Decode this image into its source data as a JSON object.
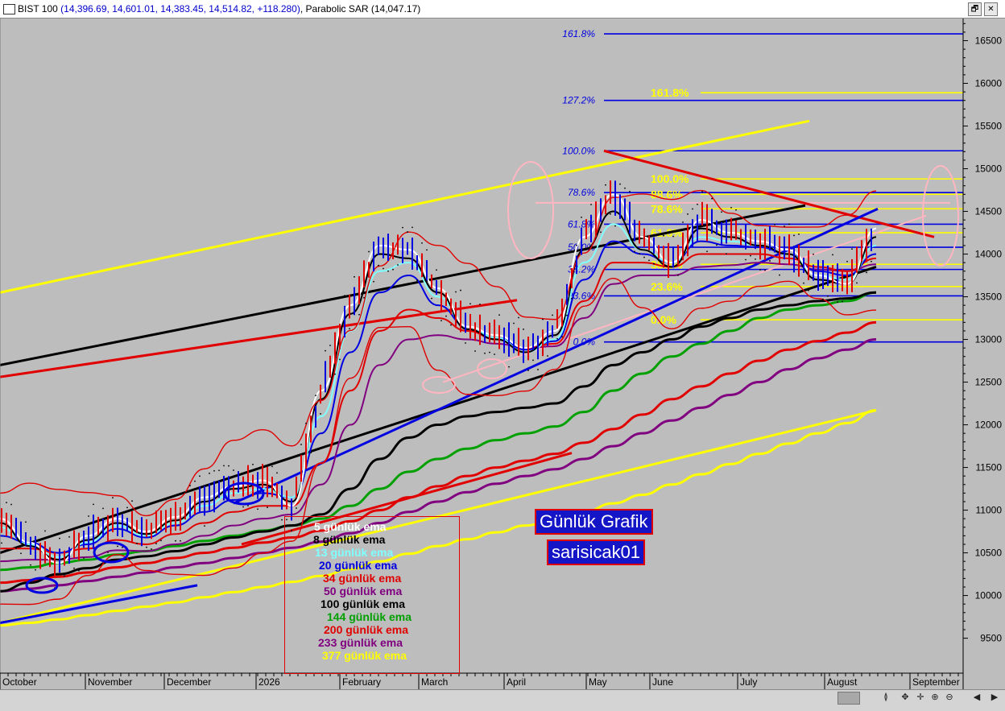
{
  "window": {
    "title_prefix": "BIST 100",
    "title_ohlc": " (14,396.69, 14,601.01, 14,383.45, 14,514.82, +118.280)",
    "title_suffix": ", Parabolic SAR (14,047.17)",
    "restore_label": "🗗",
    "close_label": "✕"
  },
  "overlays": {
    "label_1": "Günlük Grafik",
    "label_2": "sarisicak01"
  },
  "legend": [
    {
      "text": "5 günlük ema",
      "color": "#ffffff"
    },
    {
      "text": "8 günlük ema",
      "color": "#000000"
    },
    {
      "text": "13 günlük ema",
      "color": "#80ffff"
    },
    {
      "text": "20 günlük ema",
      "color": "#0000e0"
    },
    {
      "text": "34 günlük ema",
      "color": "#e00000"
    },
    {
      "text": "50 günlük ema",
      "color": "#800080"
    },
    {
      "text": "100 günlük ema",
      "color": "#000000"
    },
    {
      "text": "144 günlük ema",
      "color": "#00a000"
    },
    {
      "text": "200 günlük ema",
      "color": "#e00000"
    },
    {
      "text": "233 günlük ema",
      "color": "#800080"
    },
    {
      "text": "377 günlük ema",
      "color": "#ffff00"
    }
  ],
  "bottom_controls": [
    "≬",
    "✥",
    "✛",
    "⊕",
    "⊖",
    "◀",
    "▶"
  ],
  "chart_data": {
    "type": "candlestick-line",
    "symbol": "BIST 100",
    "ylim": [
      9100,
      16750
    ],
    "y_ticks": [
      9500,
      10000,
      10500,
      11000,
      11500,
      12000,
      12500,
      13000,
      13500,
      14000,
      14500,
      15000,
      15500,
      16000,
      16500
    ],
    "x_labels": [
      "October",
      "November",
      "December",
      "2026",
      "February",
      "March",
      "April",
      "May",
      "June",
      "July",
      "August",
      "September"
    ],
    "fib_blue": [
      {
        "label": "161.8%",
        "value": 16580
      },
      {
        "label": "127.2%",
        "value": 15800
      },
      {
        "label": "100.0%",
        "value": 15210
      },
      {
        "label": "78.6%",
        "value": 14720
      },
      {
        "label": "61.8%",
        "value": 14350
      },
      {
        "label": "50.0%",
        "value": 14080
      },
      {
        "label": "38.2%",
        "value": 13820
      },
      {
        "label": "23.6%",
        "value": 13510
      },
      {
        "label": "0.0%",
        "value": 12970
      }
    ],
    "fib_yellow": [
      {
        "label": "161.8%",
        "value": 15890
      },
      {
        "label": "100.0%",
        "value": 14880
      },
      {
        "label": "88.6%",
        "value": 14700
      },
      {
        "label": "78.6%",
        "value": 14530
      },
      {
        "label": "61.8%",
        "value": 14250
      },
      {
        "label": "38.2%",
        "value": 13880
      },
      {
        "label": "23.6%",
        "value": 13620
      },
      {
        "label": "0.0%",
        "value": 13230
      }
    ],
    "series": [
      {
        "color": "#ffffff",
        "values": [
          10900,
          10620,
          10380,
          10700,
          10900,
          10750,
          10920,
          11150,
          11280,
          11350,
          11050,
          12400,
          13400,
          14100,
          14050,
          13600,
          13150,
          13050,
          12900,
          13100,
          14200,
          14700,
          14200,
          13900,
          14400,
          14250,
          14150,
          14050,
          13750,
          13650,
          14300
        ]
      },
      {
        "color": "#000000",
        "values": [
          10850,
          10580,
          10420,
          10650,
          10850,
          10720,
          10880,
          11100,
          11250,
          11300,
          11100,
          12300,
          13300,
          14000,
          13950,
          13550,
          13120,
          13000,
          12850,
          13050,
          14050,
          14500,
          14050,
          13850,
          14300,
          14200,
          14100,
          14000,
          13700,
          13650,
          14200
        ]
      },
      {
        "color": "#80ffff",
        "values": [
          10800,
          10600,
          10450,
          10620,
          10820,
          10700,
          10850,
          11050,
          11200,
          11250,
          11150,
          12100,
          13100,
          13800,
          13900,
          13500,
          13150,
          13020,
          12850,
          13000,
          13900,
          14350,
          14050,
          13900,
          14200,
          14150,
          14100,
          14000,
          13750,
          13700,
          14100
        ]
      },
      {
        "color": "#0000e0",
        "values": [
          10700,
          10620,
          10500,
          10600,
          10780,
          10680,
          10820,
          10980,
          11120,
          11200,
          11150,
          11900,
          12850,
          13550,
          13750,
          13400,
          13150,
          13020,
          12880,
          12980,
          13700,
          14150,
          14000,
          13900,
          14150,
          14100,
          14080,
          14000,
          13800,
          13750,
          14000
        ]
      },
      {
        "color": "#e00000",
        "values": [
          10550,
          10550,
          10500,
          10550,
          10650,
          10600,
          10720,
          10850,
          10980,
          11050,
          11050,
          11550,
          12400,
          13100,
          13350,
          13250,
          13100,
          13000,
          12900,
          12950,
          13450,
          13900,
          13900,
          13850,
          14000,
          14000,
          14000,
          13950,
          13850,
          13800,
          13950
        ]
      },
      {
        "color": "#800080",
        "values": [
          10400,
          10420,
          10420,
          10450,
          10530,
          10520,
          10600,
          10700,
          10820,
          10900,
          10950,
          11300,
          12000,
          12700,
          13000,
          13050,
          13000,
          12950,
          12900,
          12920,
          13250,
          13650,
          13750,
          13750,
          13850,
          13870,
          13900,
          13880,
          13820,
          13800,
          13880
        ]
      },
      {
        "color": "#000000",
        "values": [
          10050,
          10150,
          10250,
          10320,
          10420,
          10460,
          10520,
          10600,
          10680,
          10750,
          10820,
          10950,
          11250,
          11600,
          11850,
          12000,
          12100,
          12150,
          12200,
          12250,
          12450,
          12700,
          12850,
          13000,
          13150,
          13250,
          13350,
          13400,
          13450,
          13480,
          13550
        ]
      },
      {
        "color": "#00a000",
        "values": [
          10300,
          10330,
          10380,
          10420,
          10480,
          10520,
          10580,
          10640,
          10700,
          10760,
          10820,
          10900,
          11050,
          11250,
          11450,
          11600,
          11720,
          11820,
          11900,
          11980,
          12150,
          12400,
          12600,
          12800,
          12950,
          13100,
          13250,
          13350,
          13400,
          13450,
          13550
        ]
      },
      {
        "color": "#e00000",
        "values": [
          10150,
          10180,
          10220,
          10270,
          10330,
          10380,
          10440,
          10500,
          10560,
          10620,
          10680,
          10760,
          10870,
          11000,
          11150,
          11280,
          11400,
          11500,
          11580,
          11660,
          11790,
          11950,
          12120,
          12300,
          12450,
          12600,
          12750,
          12880,
          12980,
          13080,
          13200
        ]
      },
      {
        "color": "#800080",
        "values": [
          10050,
          10080,
          10120,
          10170,
          10220,
          10270,
          10330,
          10380,
          10440,
          10500,
          10560,
          10630,
          10730,
          10850,
          10980,
          11100,
          11210,
          11310,
          11400,
          11480,
          11600,
          11750,
          11900,
          12050,
          12200,
          12350,
          12500,
          12650,
          12780,
          12880,
          13000
        ]
      },
      {
        "color": "#ffff00",
        "values": [
          9650,
          9680,
          9720,
          9770,
          9820,
          9870,
          9920,
          9980,
          10040,
          10100,
          10160,
          10230,
          10310,
          10400,
          10490,
          10580,
          10660,
          10740,
          10820,
          10900,
          10980,
          11080,
          11180,
          11300,
          11420,
          11540,
          11660,
          11780,
          11900,
          12020,
          12170
        ]
      }
    ],
    "trendlines": [
      {
        "color": "#ffff00",
        "from": [
          0,
          13550
        ],
        "to": [
          1005,
          15560
        ]
      },
      {
        "color": "#ffff00",
        "from": [
          0,
          9680
        ],
        "to": [
          1088,
          12170
        ]
      },
      {
        "color": "#000000",
        "from": [
          0,
          12700
        ],
        "to": [
          1000,
          14570
        ]
      },
      {
        "color": "#000000",
        "from": [
          0,
          10500
        ],
        "to": [
          1088,
          13850
        ]
      },
      {
        "color": "#e00000",
        "from": [
          0,
          12560
        ],
        "to": [
          642,
          13460
        ]
      },
      {
        "color": "#e00000",
        "from": [
          750,
          15210
        ],
        "to": [
          1160,
          14200
        ]
      },
      {
        "color": "#0000e0",
        "from": [
          0,
          9680
        ],
        "to": [
          245,
          10120
        ]
      },
      {
        "color": "#0000e0",
        "from": [
          290,
          11080
        ],
        "to": [
          1090,
          14530
        ]
      },
      {
        "color": "#e00000",
        "from": [
          300,
          10600
        ],
        "to": [
          710,
          11670
        ]
      }
    ]
  }
}
